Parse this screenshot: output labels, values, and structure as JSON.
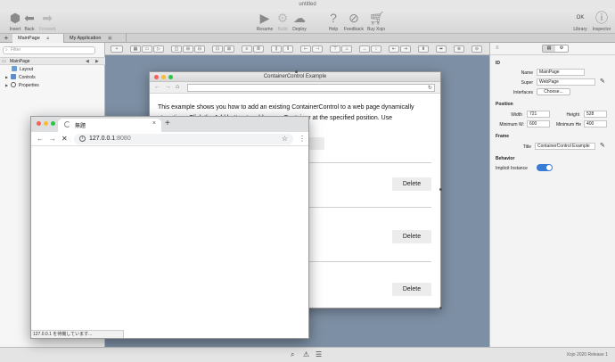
{
  "ide": {
    "window_title": "untitled",
    "toolbar": {
      "insert": "Insert",
      "back": "Back",
      "forward": "Forward",
      "resume": "Resume",
      "build": "Build",
      "deploy": "Deploy",
      "help": "Help",
      "feedback": "Feedback",
      "buy": "Buy Xojo",
      "library": "Library",
      "inspector": "Inspector",
      "library_badge": "OK"
    },
    "tabs": [
      {
        "label": "MainPage"
      },
      {
        "label": "My Application"
      }
    ],
    "navigator": {
      "filter_placeholder": "Filter",
      "root": "MainPage",
      "items": [
        "Layout",
        "Controls",
        "Properties"
      ]
    },
    "inspector": {
      "sections": {
        "id": "ID",
        "position": "Position",
        "frame": "Frame",
        "behavior": "Behavior"
      },
      "name_label": "Name",
      "name_value": "MainPage",
      "super_label": "Super",
      "super_value": "WebPage",
      "interfaces_label": "Interfaces",
      "interfaces_button": "Choose...",
      "width_label": "Width",
      "width_value": "721",
      "height_label": "Height",
      "height_value": "528",
      "minw_label": "Minimum W:",
      "minw_value": "600",
      "minh_label": "Minimum He",
      "minh_value": "400",
      "title_label": "Title",
      "title_value": "ContainerControl Example",
      "implicit_label": "Implicit Instance"
    },
    "status": {
      "version": "Xojo 2020 Release 1"
    }
  },
  "cc_window": {
    "title": "ContainerControl Example",
    "description_line1": "This example shows you how to add an existing ContainerControl to a web page dynamically",
    "description_line2": "at runtime. Click the Add button to add a new Container at the specified position.  Use",
    "delete_label": "Delete"
  },
  "browser": {
    "tab_title": "無題",
    "url_host": "127.0.0.1",
    "url_port": ":8080",
    "status_text": "127.0.0.1 を待機しています..."
  }
}
